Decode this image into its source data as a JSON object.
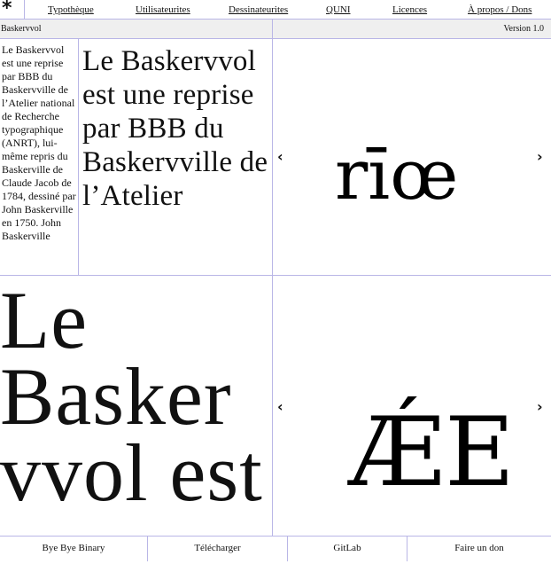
{
  "nav": {
    "logo": "*",
    "links": [
      "Typothèque",
      "Utilisateurites",
      "Dessinateurites",
      "QUNI",
      "Licences",
      "À propos / Dons"
    ]
  },
  "font": {
    "name": "Baskervvol",
    "version": "Version 1.0"
  },
  "specimen": {
    "description": "Le Baskervvol est une reprise par BBB du Baskervville de l’Atelier national de Recherche typographique (ANRT), lui-même repris du Baskerville de Claude Jacob de 1784, dessiné par John Baskerville en 1750. John Baskerville",
    "medium_text": "Le Baskervvol est une reprise par BBB du Baskervville de l’Atelier",
    "large_text": "Le Basker vvol est une"
  },
  "glyph_viewers": [
    {
      "glyph": "rīœ",
      "prev": "‹",
      "next": "›"
    },
    {
      "glyph": "ǼE",
      "prev": "‹",
      "next": "›"
    }
  ],
  "footer": {
    "links": [
      "Bye Bye Binary",
      "Télécharger",
      "GitLab",
      "Faire un don"
    ]
  }
}
